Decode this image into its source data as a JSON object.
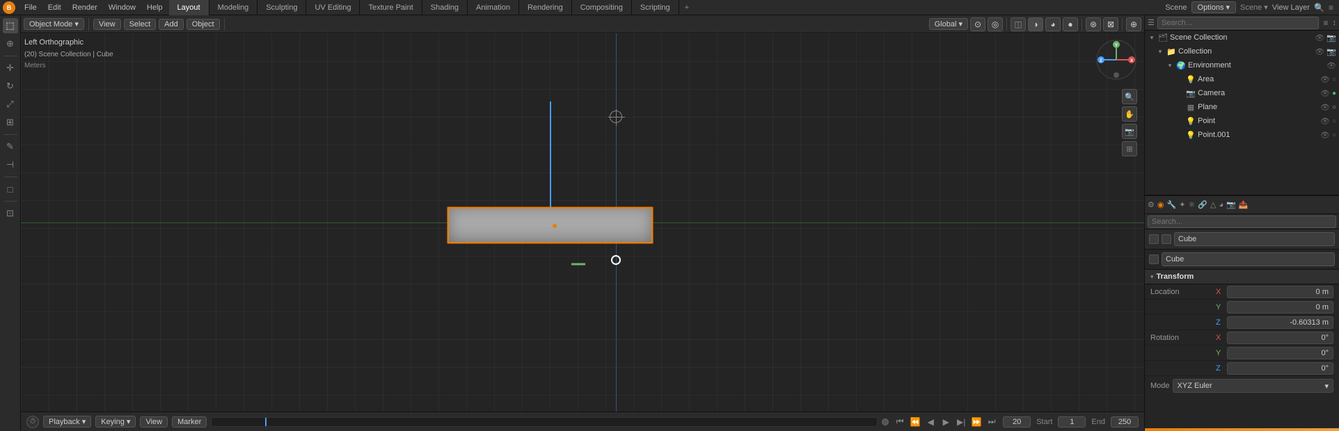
{
  "app": {
    "logo": "B",
    "menu_items": [
      "File",
      "Edit",
      "Render",
      "Window",
      "Help"
    ],
    "workspace_tabs": [
      {
        "label": "Layout",
        "active": true
      },
      {
        "label": "Modeling",
        "active": false
      },
      {
        "label": "Sculpting",
        "active": false
      },
      {
        "label": "UV Editing",
        "active": false
      },
      {
        "label": "Texture Paint",
        "active": false
      },
      {
        "label": "Shading",
        "active": false
      },
      {
        "label": "Animation",
        "active": false
      },
      {
        "label": "Rendering",
        "active": false
      },
      {
        "label": "Compositing",
        "active": false
      },
      {
        "label": "Scripting",
        "active": false
      }
    ],
    "tab_plus": "+",
    "scene_label": "Scene",
    "options_label": "Options ▾",
    "view_layer_label": "View Layer",
    "search_placeholder": "🔍",
    "filter_icon": "≡"
  },
  "viewport": {
    "header": {
      "mode_label": "Object Mode",
      "mode_dropdown_arrow": "▾",
      "view_label": "View",
      "select_label": "Select",
      "add_label": "Add",
      "object_label": "Object",
      "global_label": "Global ▾",
      "gizmo_icons": [
        "↗",
        "⊞",
        "◉",
        "⚬",
        "∿"
      ]
    },
    "info": {
      "view_mode": "Left Orthographic",
      "collection_path": "(20) Scene Collection | Cube",
      "units": "Meters"
    },
    "gizmo": {
      "y_label": "Y",
      "minus_y_label": "-Y",
      "x_label": "X",
      "z_label": "Z"
    }
  },
  "timeline": {
    "playback_label": "Playback ▾",
    "keying_label": "Keying ▾",
    "view_label": "View",
    "marker_label": "Marker",
    "frame_current": "20",
    "start_label": "Start",
    "start_value": "1",
    "end_label": "End",
    "end_value": "250"
  },
  "outliner": {
    "search_placeholder": "Search...",
    "scene_collection_label": "Scene Collection",
    "items": [
      {
        "label": "Collection",
        "indent": 1,
        "icon": "📁",
        "col": "col-orange",
        "expanded": true
      },
      {
        "label": "Environment",
        "indent": 2,
        "icon": "🌍",
        "col": "col-grey",
        "expanded": true
      },
      {
        "label": "Area",
        "indent": 3,
        "icon": "💡",
        "col": "col-grey"
      },
      {
        "label": "Camera",
        "indent": 3,
        "icon": "📷",
        "col": "col-green"
      },
      {
        "label": "Plane",
        "indent": 3,
        "icon": "▦",
        "col": "col-grey"
      },
      {
        "label": "Point",
        "indent": 3,
        "icon": "💡",
        "col": "col-grey"
      },
      {
        "label": "Point.001",
        "indent": 3,
        "icon": "💡",
        "col": "col-grey"
      }
    ]
  },
  "properties": {
    "search_placeholder": "Search...",
    "object_name": "Cube",
    "object_data_name": "Cube",
    "transform": {
      "title": "Transform",
      "location": {
        "label": "Location",
        "x_label": "X",
        "x_value": "0 m",
        "y_label": "Y",
        "y_value": "0 m",
        "z_label": "Z",
        "z_value": "-0.60313 m"
      },
      "rotation": {
        "label": "Rotation",
        "x_label": "X",
        "x_value": "0°",
        "y_label": "Y",
        "y_value": "0°",
        "z_label": "Z",
        "z_value": "0°"
      },
      "mode": {
        "label": "Mode",
        "value": "XYZ Euler"
      }
    }
  },
  "colors": {
    "accent_orange": "#e87d0d",
    "accent_blue": "#4a9eff",
    "accent_green": "#6db56d",
    "selected_bg": "#1d4065",
    "panel_bg": "#252525",
    "header_bg": "#2b2b2b",
    "viewport_bg": "#242424"
  }
}
